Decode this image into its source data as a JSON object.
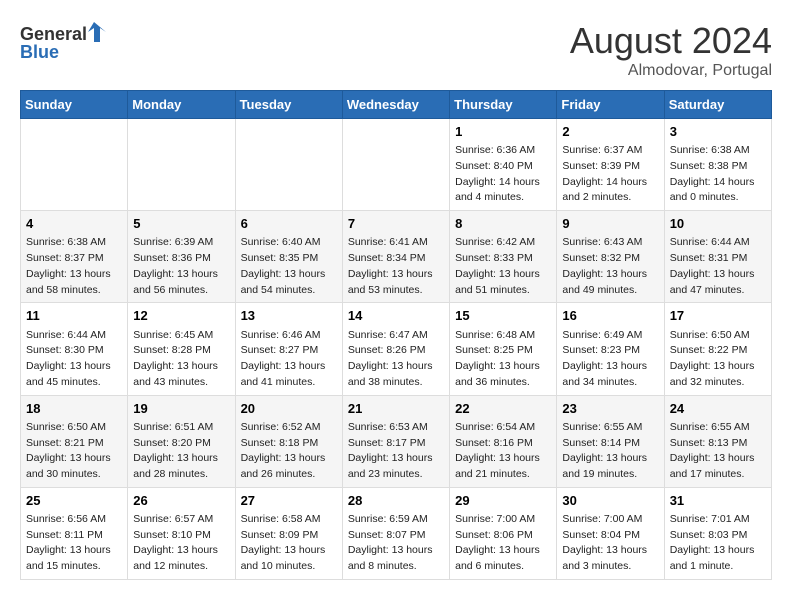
{
  "header": {
    "logo_general": "General",
    "logo_blue": "Blue",
    "month_year": "August 2024",
    "location": "Almodovar, Portugal"
  },
  "days_of_week": [
    "Sunday",
    "Monday",
    "Tuesday",
    "Wednesday",
    "Thursday",
    "Friday",
    "Saturday"
  ],
  "weeks": [
    [
      {
        "day": "",
        "info": ""
      },
      {
        "day": "",
        "info": ""
      },
      {
        "day": "",
        "info": ""
      },
      {
        "day": "",
        "info": ""
      },
      {
        "day": "1",
        "info": "Sunrise: 6:36 AM\nSunset: 8:40 PM\nDaylight: 14 hours\nand 4 minutes."
      },
      {
        "day": "2",
        "info": "Sunrise: 6:37 AM\nSunset: 8:39 PM\nDaylight: 14 hours\nand 2 minutes."
      },
      {
        "day": "3",
        "info": "Sunrise: 6:38 AM\nSunset: 8:38 PM\nDaylight: 14 hours\nand 0 minutes."
      }
    ],
    [
      {
        "day": "4",
        "info": "Sunrise: 6:38 AM\nSunset: 8:37 PM\nDaylight: 13 hours\nand 58 minutes."
      },
      {
        "day": "5",
        "info": "Sunrise: 6:39 AM\nSunset: 8:36 PM\nDaylight: 13 hours\nand 56 minutes."
      },
      {
        "day": "6",
        "info": "Sunrise: 6:40 AM\nSunset: 8:35 PM\nDaylight: 13 hours\nand 54 minutes."
      },
      {
        "day": "7",
        "info": "Sunrise: 6:41 AM\nSunset: 8:34 PM\nDaylight: 13 hours\nand 53 minutes."
      },
      {
        "day": "8",
        "info": "Sunrise: 6:42 AM\nSunset: 8:33 PM\nDaylight: 13 hours\nand 51 minutes."
      },
      {
        "day": "9",
        "info": "Sunrise: 6:43 AM\nSunset: 8:32 PM\nDaylight: 13 hours\nand 49 minutes."
      },
      {
        "day": "10",
        "info": "Sunrise: 6:44 AM\nSunset: 8:31 PM\nDaylight: 13 hours\nand 47 minutes."
      }
    ],
    [
      {
        "day": "11",
        "info": "Sunrise: 6:44 AM\nSunset: 8:30 PM\nDaylight: 13 hours\nand 45 minutes."
      },
      {
        "day": "12",
        "info": "Sunrise: 6:45 AM\nSunset: 8:28 PM\nDaylight: 13 hours\nand 43 minutes."
      },
      {
        "day": "13",
        "info": "Sunrise: 6:46 AM\nSunset: 8:27 PM\nDaylight: 13 hours\nand 41 minutes."
      },
      {
        "day": "14",
        "info": "Sunrise: 6:47 AM\nSunset: 8:26 PM\nDaylight: 13 hours\nand 38 minutes."
      },
      {
        "day": "15",
        "info": "Sunrise: 6:48 AM\nSunset: 8:25 PM\nDaylight: 13 hours\nand 36 minutes."
      },
      {
        "day": "16",
        "info": "Sunrise: 6:49 AM\nSunset: 8:23 PM\nDaylight: 13 hours\nand 34 minutes."
      },
      {
        "day": "17",
        "info": "Sunrise: 6:50 AM\nSunset: 8:22 PM\nDaylight: 13 hours\nand 32 minutes."
      }
    ],
    [
      {
        "day": "18",
        "info": "Sunrise: 6:50 AM\nSunset: 8:21 PM\nDaylight: 13 hours\nand 30 minutes."
      },
      {
        "day": "19",
        "info": "Sunrise: 6:51 AM\nSunset: 8:20 PM\nDaylight: 13 hours\nand 28 minutes."
      },
      {
        "day": "20",
        "info": "Sunrise: 6:52 AM\nSunset: 8:18 PM\nDaylight: 13 hours\nand 26 minutes."
      },
      {
        "day": "21",
        "info": "Sunrise: 6:53 AM\nSunset: 8:17 PM\nDaylight: 13 hours\nand 23 minutes."
      },
      {
        "day": "22",
        "info": "Sunrise: 6:54 AM\nSunset: 8:16 PM\nDaylight: 13 hours\nand 21 minutes."
      },
      {
        "day": "23",
        "info": "Sunrise: 6:55 AM\nSunset: 8:14 PM\nDaylight: 13 hours\nand 19 minutes."
      },
      {
        "day": "24",
        "info": "Sunrise: 6:55 AM\nSunset: 8:13 PM\nDaylight: 13 hours\nand 17 minutes."
      }
    ],
    [
      {
        "day": "25",
        "info": "Sunrise: 6:56 AM\nSunset: 8:11 PM\nDaylight: 13 hours\nand 15 minutes."
      },
      {
        "day": "26",
        "info": "Sunrise: 6:57 AM\nSunset: 8:10 PM\nDaylight: 13 hours\nand 12 minutes."
      },
      {
        "day": "27",
        "info": "Sunrise: 6:58 AM\nSunset: 8:09 PM\nDaylight: 13 hours\nand 10 minutes."
      },
      {
        "day": "28",
        "info": "Sunrise: 6:59 AM\nSunset: 8:07 PM\nDaylight: 13 hours\nand 8 minutes."
      },
      {
        "day": "29",
        "info": "Sunrise: 7:00 AM\nSunset: 8:06 PM\nDaylight: 13 hours\nand 6 minutes."
      },
      {
        "day": "30",
        "info": "Sunrise: 7:00 AM\nSunset: 8:04 PM\nDaylight: 13 hours\nand 3 minutes."
      },
      {
        "day": "31",
        "info": "Sunrise: 7:01 AM\nSunset: 8:03 PM\nDaylight: 13 hours\nand 1 minute."
      }
    ]
  ]
}
